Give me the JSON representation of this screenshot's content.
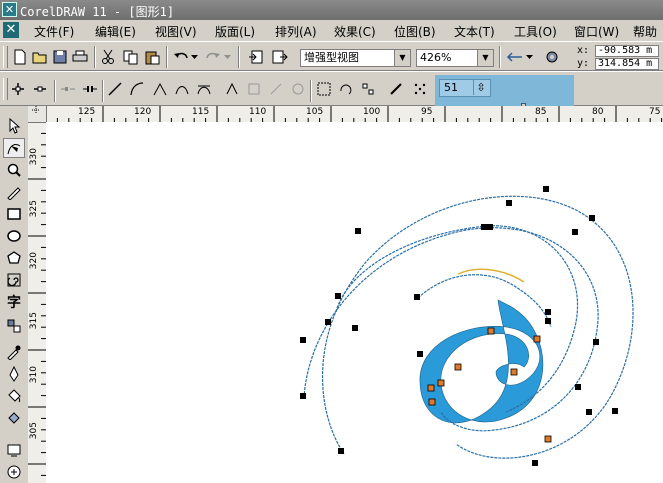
{
  "window": {
    "title": "CorelDRAW 11 - [图形1]"
  },
  "menu": [
    "文件(F)",
    "编辑(E)",
    "视图(V)",
    "版面(L)",
    "排列(A)",
    "效果(C)",
    "位图(B)",
    "文本(T)",
    "工具(O)",
    "窗口(W)",
    "帮助"
  ],
  "toolbar": {
    "view_mode": "增强型视图",
    "zoom": "426%"
  },
  "coords": {
    "x_label": "x:",
    "x_value": "-90.583 m",
    "y_label": "y:",
    "y_value": "314.854 m"
  },
  "node_panel": {
    "value": "51"
  },
  "ruler": {
    "h_labels": [
      "125",
      "120",
      "115",
      "110",
      "105",
      "100",
      "95",
      "85",
      "80",
      "75"
    ],
    "v_labels": [
      "330",
      "325",
      "320",
      "315",
      "310",
      "305"
    ]
  },
  "colors": {
    "spiral_fill": "#2a9ad8",
    "selection_panel": "#7fb7d9",
    "node": "#000000",
    "node_accent": "#e07a2a"
  },
  "toolbox": [
    "pick-tool",
    "shape-tool",
    "zoom-tool",
    "freehand-tool",
    "rectangle-tool",
    "ellipse-tool",
    "polygon-tool",
    "spiral-tool",
    "text-tool",
    "interactive-blend-tool",
    "eyedropper-tool",
    "outline-tool",
    "fill-tool",
    "interactive-fill-tool",
    "view-tool",
    "zoom-extra-tool"
  ]
}
